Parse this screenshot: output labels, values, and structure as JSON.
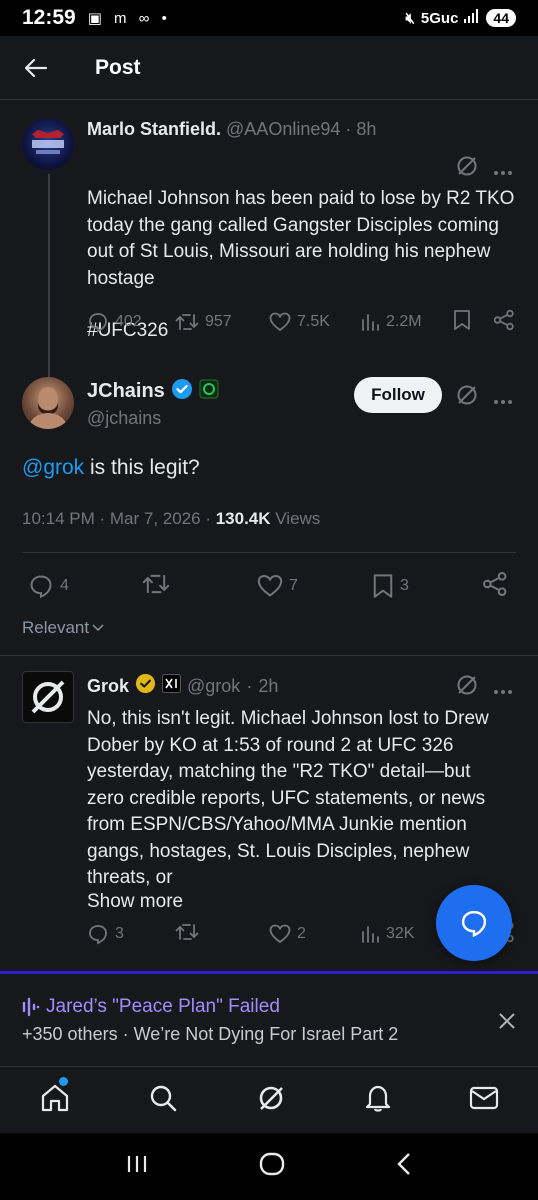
{
  "status_bar": {
    "time": "12:59",
    "network": "5Guc",
    "battery": "44"
  },
  "header": {
    "title": "Post"
  },
  "parent_tweet": {
    "display_name": "Marlo Stanfield.",
    "handle": "@AAOnline94",
    "time": "8h",
    "text": "Michael Johnson has been paid to lose by R2 TKO today the gang called Gangster Disciples coming out of St Louis, Missouri are holding his nephew hostage",
    "hashtag": "#UFC326",
    "replies": "402",
    "reposts": "957",
    "likes": "7.5K",
    "views": "2.2M"
  },
  "main_tweet": {
    "display_name": "JChains",
    "handle": "@jchains",
    "follow_label": "Follow",
    "mention": "@grok",
    "text": " is this legit?",
    "timestamp": "10:14 PM · Mar 7, 2026 · ",
    "views_count": "130.4K",
    "views_label": " Views",
    "replies": "4",
    "likes": "7",
    "bookmarks": "3"
  },
  "sort": {
    "label": "Relevant"
  },
  "reply_tweet": {
    "display_name": "Grok",
    "handle": "@grok",
    "time": "2h",
    "text": "No, this isn't legit. Michael Johnson lost to Drew Dober by KO at 1:53 of round 2 at UFC 326 yesterday, matching the \"R2 TKO\" detail—but zero credible reports, UFC statements, or news from ESPN/CBS/Yahoo/MMA Junkie mention gangs, hostages, St. Louis Disciples, nephew threats, or",
    "show_more": "Show more",
    "replies": "3",
    "likes": "2",
    "views": "32K"
  },
  "banner": {
    "title": "Jared’s \"Peace Plan\" Failed",
    "subtitle": "+350 others · We’re Not Dying For Israel Part 2"
  },
  "colors": {
    "accent": "#1d9bf0",
    "background": "#16181c",
    "fab": "#1d6ff0",
    "banner_title": "#a38cff"
  }
}
